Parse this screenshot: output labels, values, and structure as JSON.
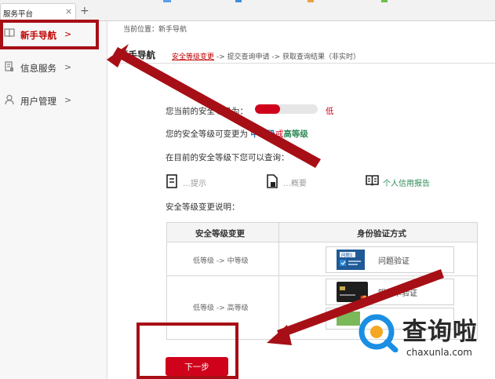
{
  "browser": {
    "tab_title": "服务平台",
    "tab_close": "×",
    "new_tab": "+"
  },
  "sidebar": {
    "items": [
      {
        "label": "新手导航",
        "chevron": ">",
        "icon": "book-icon",
        "active": true
      },
      {
        "label": "信息服务",
        "chevron": ">",
        "icon": "document-icon",
        "active": false
      },
      {
        "label": "用户管理",
        "chevron": ">",
        "icon": "user-icon",
        "active": false
      }
    ]
  },
  "breadcrumb": "当前位置：新手导航",
  "page_title": "新手导航",
  "steps": {
    "current": "安全等级变更",
    "rest": " -> 提交查询申请 -> 获取查询结果（非实时）"
  },
  "security": {
    "label": "您当前的安全等级为：",
    "level_text": "低",
    "level_fraction": 0.4,
    "change_prefix": "您的安全等级可变更为",
    "change_mid": "中等级",
    "change_or": "或",
    "change_high": "高等级",
    "query_label": "在目前的安全等级下您可以查询：",
    "queries": [
      {
        "icon": "report-icon",
        "label": "…提示"
      },
      {
        "icon": "file-icon",
        "label": "…概要"
      },
      {
        "icon": "open-book-icon",
        "label": "个人信用报告"
      }
    ],
    "explain_label": "安全等级变更说明："
  },
  "table": {
    "headers": [
      "安全等级变更",
      "身份验证方式"
    ],
    "rows": [
      {
        "level_from": "低等级",
        "level_to": "中等级",
        "arrow": "->",
        "methods": [
          "问题验证"
        ]
      },
      {
        "level_from": "低等级",
        "level_to": "高等级",
        "arrow": "->",
        "methods": [
          "银行卡验证",
          ""
        ]
      }
    ],
    "question_card_text": "问题1"
  },
  "next_button": "下一步",
  "watermark": {
    "text": "查询啦",
    "sub": "chaxunla.com"
  },
  "colors": {
    "accent_red": "#d0021b",
    "annotation_red": "#a70f16",
    "link_blue": "#2d6eb5",
    "link_green": "#2e8b57",
    "watermark_blue": "#1a8fe3",
    "watermark_orange": "#f5a623"
  }
}
